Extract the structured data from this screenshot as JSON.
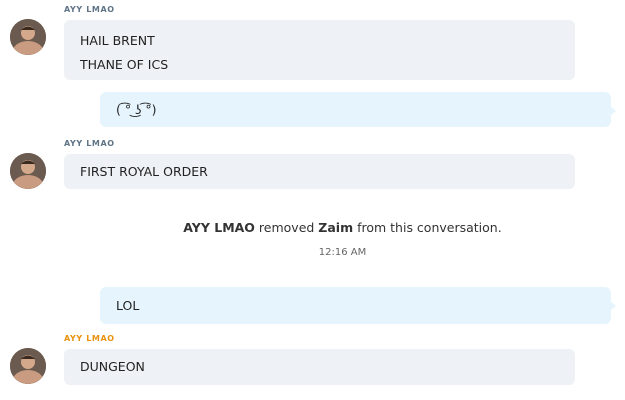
{
  "colors": {
    "sender_default": "#5f7486",
    "sender_highlight": "#e8920f",
    "incoming_bubble": "#eef1f5",
    "outgoing_bubble": "#e6f5fd"
  },
  "messages": [
    {
      "sender": "AYY LMAO",
      "lines": [
        "HAIL BRENT",
        "THANE OF ICS"
      ]
    },
    {
      "outgoing_text": "( ͡° ͜ʖ ͡°)"
    },
    {
      "sender": "AYY LMAO",
      "lines": [
        "FIRST ROYAL ORDER"
      ]
    },
    {
      "system": {
        "actor": "AYY LMAO",
        "action": " removed ",
        "target": "Zaim",
        "suffix": " from this conversation."
      },
      "timestamp": "12:16 AM"
    },
    {
      "outgoing_text": "LOL"
    },
    {
      "sender": "AYY LMAO",
      "lines": [
        "DUNGEON"
      ]
    }
  ]
}
